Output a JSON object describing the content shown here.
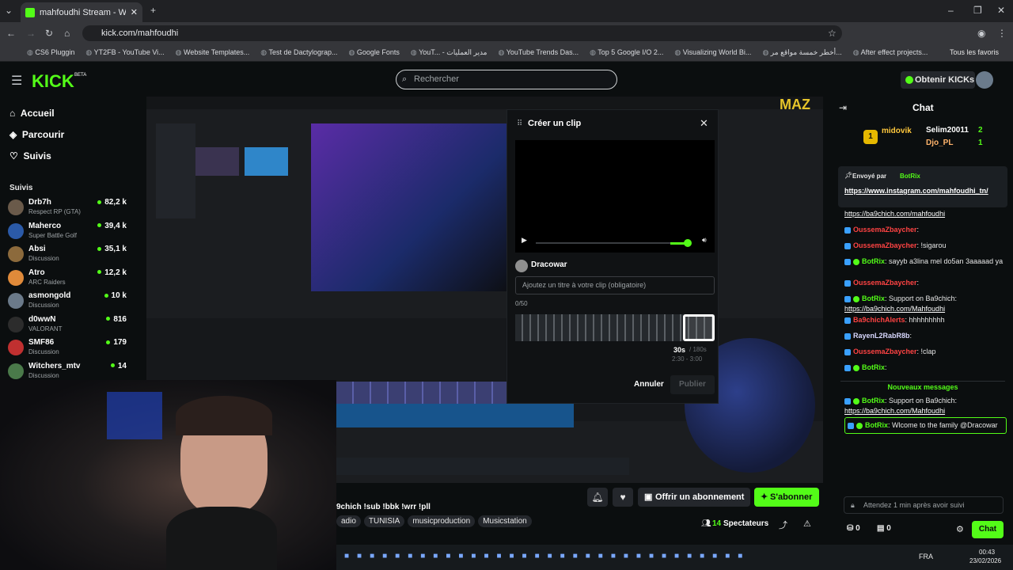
{
  "browser": {
    "tab_title": "mahfoudhi Stream - Watch Live",
    "url": "kick.com/mahfoudhi",
    "bookmarks": [
      "CS6 Pluggin",
      "YT2FB - YouTube Vi...",
      "Website Templates...",
      "Test de Dactylograp...",
      "Google Fonts",
      "YouT... - مدير العمليات",
      "YouTube Trends Das...",
      "Top 5 Google I/O 2...",
      "Visualizing World Bi...",
      "أخطر خمسة مواقع مر...",
      "After effect projects..."
    ],
    "all_favorites": "Tous les favoris"
  },
  "site": {
    "logo": "KICK",
    "logo_beta": "BETA",
    "search_placeholder": "Rechercher",
    "cta": "Obtenir KICKs"
  },
  "nav": [
    {
      "label": "Accueil"
    },
    {
      "label": "Parcourir"
    },
    {
      "label": "Suivis"
    }
  ],
  "follows_title": "Suivis",
  "follows": [
    {
      "name": "Drb7h",
      "cat": "Respect RP (GTA)",
      "viewers": "82,2 k"
    },
    {
      "name": "Maherco",
      "cat": "Super Battle Golf",
      "viewers": "39,4 k"
    },
    {
      "name": "Absi",
      "cat": "Discussion",
      "viewers": "35,1 k"
    },
    {
      "name": "Atro",
      "cat": "ARC Raiders",
      "viewers": "12,2 k"
    },
    {
      "name": "asmongold",
      "cat": "Discussion",
      "viewers": "10 k"
    },
    {
      "name": "d0wwN",
      "cat": "VALORANT",
      "viewers": "816"
    },
    {
      "name": "SMF86",
      "cat": "Discussion",
      "viewers": "179"
    },
    {
      "name": "Witchers_mtv",
      "cat": "Discussion",
      "viewers": "14"
    }
  ],
  "clip": {
    "title": "Créer un clip",
    "user": "Dracowar",
    "placeholder": "Ajoutez un titre à votre clip (obligatoire)",
    "counter": "0/50",
    "duration": "30s",
    "max": "/ 180s",
    "range": "2:30 - 3:00",
    "cancel": "Annuler",
    "publish": "Publier",
    "volume_fraction": 0.84
  },
  "stream": {
    "title_fragment": "9chich !sub !bbk !wrr !pll",
    "tags": [
      "adio",
      "TUNISIA",
      "musicproduction",
      "Musicstation"
    ],
    "subscribe_gift": "Offrir un abonnement",
    "subscribe": "S'abonner",
    "viewers_count": "14",
    "viewers_label": "Spectateurs"
  },
  "chat": {
    "title": "Chat",
    "top": [
      {
        "rank": "1",
        "name": "midovik"
      },
      {
        "name": "Selim20011",
        "count": "2"
      },
      {
        "name": "Djo_PL",
        "count": "1"
      }
    ],
    "pinned_by": "Envoyé par",
    "pinned_user": "BotRix",
    "pinned_link": "https://www.instagram.com/mahfoudhi_tn/",
    "messages": [
      {
        "user": "",
        "text": "https://ba9chich.com/mahfoudhi",
        "link": true
      },
      {
        "user": "OussemaZbaycher",
        "text": ":"
      },
      {
        "user": "OussemaZbaycher",
        "text": ": !sigarou"
      },
      {
        "user": "BotRix",
        "text": ": sayyb a3lina mel do5an 3aaaaad ya",
        "bot": true
      },
      {
        "user": "OussemaZbaycher",
        "text": ":"
      },
      {
        "user": "BotRix",
        "text": ": Support on Ba9chich:",
        "bot": true,
        "link2": "https://ba9chich.com/Mahfoudhi"
      },
      {
        "user": "Ba9chichAlerts",
        "text": ": hhhhhhhhh"
      },
      {
        "user": "RayenL2RabR8b",
        "text": ":"
      },
      {
        "user": "OussemaZbaycher",
        "text": ": !clap"
      },
      {
        "user": "BotRix",
        "text": ":",
        "bot": true
      }
    ],
    "new_messages": "Nouveaux messages",
    "new": [
      {
        "user": "BotRix",
        "text": ": Support on Ba9chich:",
        "link2": "https://ba9chich.com/Mahfoudhi"
      },
      {
        "user": "BotRix",
        "text": ": Wlcome to the family @Dracowar"
      }
    ],
    "input_placeholder": "Attendez 1 min après avoir suivi",
    "send": "Chat",
    "count_a": "0",
    "count_b": "0"
  },
  "taskbar": {
    "lang": "FRA",
    "time": "00:43",
    "date": "23/02/2026"
  },
  "colors": {
    "accent": "#53fc18",
    "username_red": "#ff4343",
    "bg": "#0b0e0f"
  }
}
